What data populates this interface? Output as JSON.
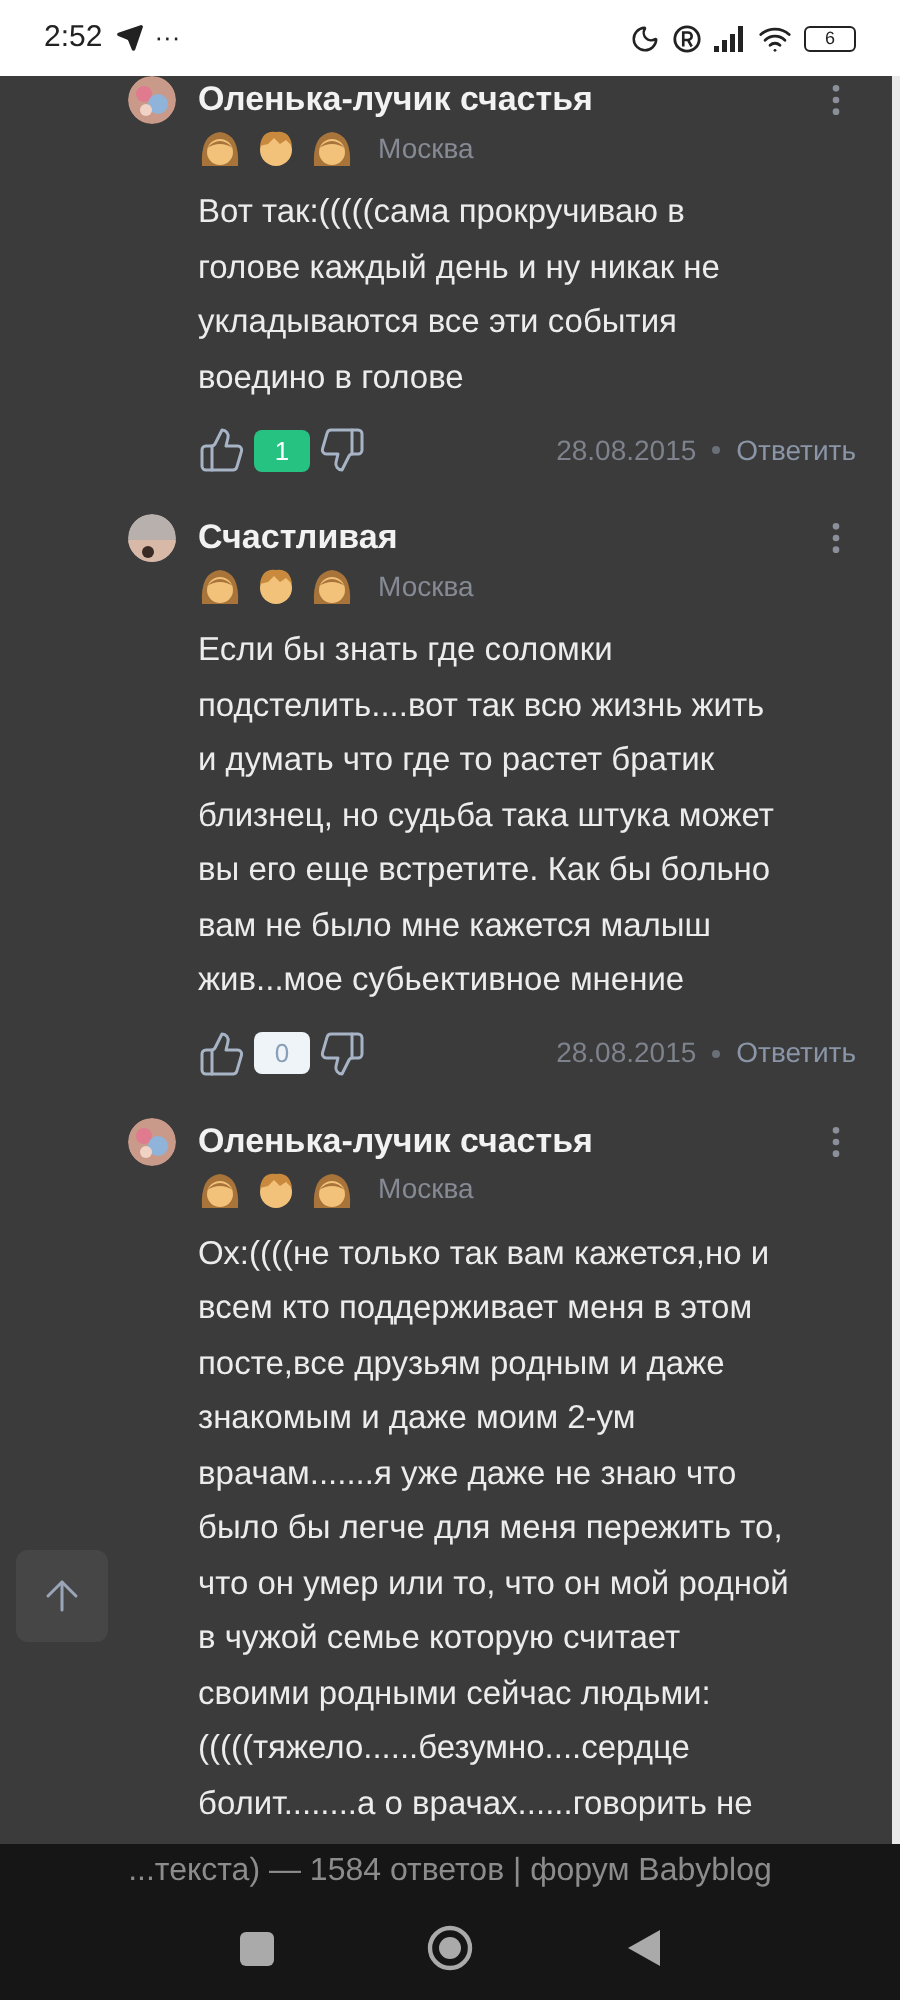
{
  "status_bar": {
    "time": "2:52",
    "more": "···",
    "battery": "6"
  },
  "comments": [
    {
      "author": "Оленька-лучик счастья",
      "city": "Москва",
      "text": "Вот так:(((((сама прокручиваю в\nголове каждый день и ну никак не\nукладываются все эти события\nвоедино в голове",
      "votes": "1",
      "positive": true,
      "date": "28.08.2015",
      "reply": "Ответить"
    },
    {
      "author": "Счастливая",
      "city": "Москва",
      "text": "Если бы знать где соломки\nподстелить....вот так всю жизнь жить\nи думать что где то растет братик\nблизнец, но судьба така штука может\nвы его еще встретите. Как бы больно\nвам не было мне кажется малыш\nжив...мое субьективное мнение",
      "votes": "0",
      "positive": false,
      "date": "28.08.2015",
      "reply": "Ответить"
    },
    {
      "author": "Оленька-лучик счастья",
      "city": "Москва",
      "text": "Ох:((((не только так вам кажется,но и\nвсем кто поддерживает меня в этом\nпосте,все друзьям родным и даже\nзнакомым и даже моим 2-ум\nврачам.......я уже даже не знаю что\nбыло бы легче для меня пережить то,\nчто он умер или то, что он мой родной\nв чужой семье которую считает\nсвоими родными сейчас людьми:\n(((((тяжело......безумно....сердце\nболит........а о врачах......говорить не"
    }
  ],
  "page_title": "...текста) — 1584 ответов | форум Babyblog"
}
